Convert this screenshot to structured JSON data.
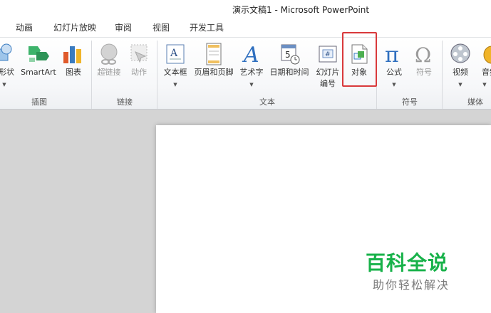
{
  "window": {
    "title": "演示文稿1 - Microsoft PowerPoint"
  },
  "tabs": [
    "动画",
    "幻灯片放映",
    "审阅",
    "视图",
    "开发工具"
  ],
  "ribbon": {
    "buttons": {
      "shapes": "形状",
      "smartart": "SmartArt",
      "chart": "图表",
      "hyperlink": "超链接",
      "action": "动作",
      "textbox": "文本框",
      "header_footer": "页眉和页脚",
      "wordart": "艺术字",
      "datetime": "日期和时间",
      "slide_number_1": "幻灯片",
      "slide_number_2": "编号",
      "object": "对象",
      "equation": "公式",
      "symbol": "符号",
      "video": "视频",
      "audio": "音频"
    },
    "groups": {
      "illustrations": "插图",
      "links": "链接",
      "text": "文本",
      "symbols": "符号",
      "media": "媒体"
    }
  },
  "watermark": {
    "main": "百科全说",
    "sub": "助你轻松解决"
  },
  "colors": {
    "highlight": "#d9393b",
    "watermark": "#18b24a"
  }
}
